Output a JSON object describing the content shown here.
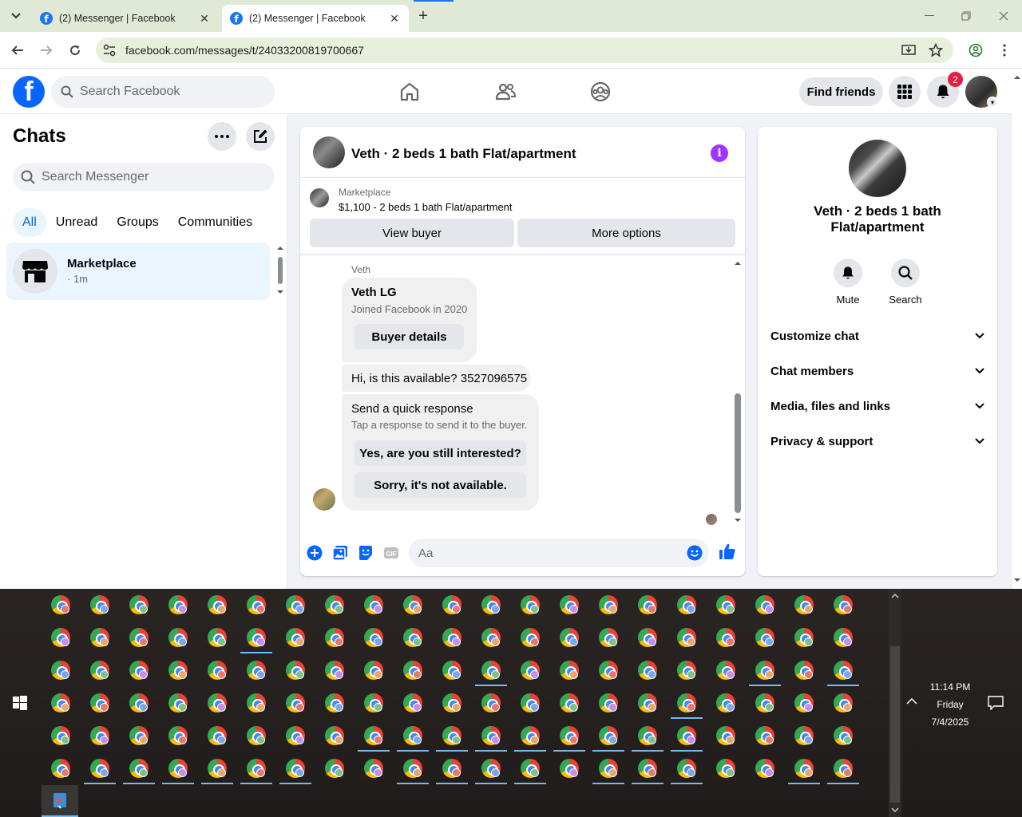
{
  "browser": {
    "tabs": [
      {
        "title": "(2) Messenger | Facebook",
        "active": false
      },
      {
        "title": "(2) Messenger | Facebook",
        "active": true
      }
    ],
    "url": "facebook.com/messages/t/24033200819700667"
  },
  "fb_header": {
    "search_placeholder": "Search Facebook",
    "find_friends": "Find friends",
    "notification_count": "2",
    "nav_icons": [
      "home-icon",
      "friends-icon",
      "groups-icon"
    ]
  },
  "chats": {
    "title": "Chats",
    "search_placeholder": "Search Messenger",
    "filters": [
      "All",
      "Unread",
      "Groups",
      "Communities"
    ],
    "active_filter": "All",
    "items": [
      {
        "name": "Marketplace",
        "meta": "· 1m"
      }
    ]
  },
  "conversation": {
    "title": "Veth · 2 beds 1 bath Flat/apartment",
    "listing": {
      "source": "Marketplace",
      "title": "$1,100 - 2 beds 1 bath Flat/apartment",
      "view_buyer": "View buyer",
      "more_options": "More options"
    },
    "sender_label": "Veth",
    "profile_card": {
      "name": "Veth LG",
      "joined": "Joined Facebook in 2020",
      "button": "Buyer details"
    },
    "message": "Hi, is this available? 3527096575",
    "quick_response": {
      "heading": "Send a quick response",
      "subtext": "Tap a response to send it to the buyer.",
      "options": [
        "Yes, are you still interested?",
        "Sorry, it's not available."
      ]
    },
    "composer_placeholder": "Aa"
  },
  "info_panel": {
    "title": "Veth · 2 beds 1 bath Flat/apartment",
    "actions": [
      "Mute",
      "Search"
    ],
    "sections": [
      "Customize chat",
      "Chat members",
      "Media, files and links",
      "Privacy & support"
    ]
  },
  "taskbar": {
    "time": "11:14 PM",
    "day": "Friday",
    "date": "7/4/2025",
    "profile_colors": [
      "#e8776b",
      "#7ba7e8",
      "#7cc08a",
      "#c78de8",
      "#e8a66b"
    ]
  }
}
